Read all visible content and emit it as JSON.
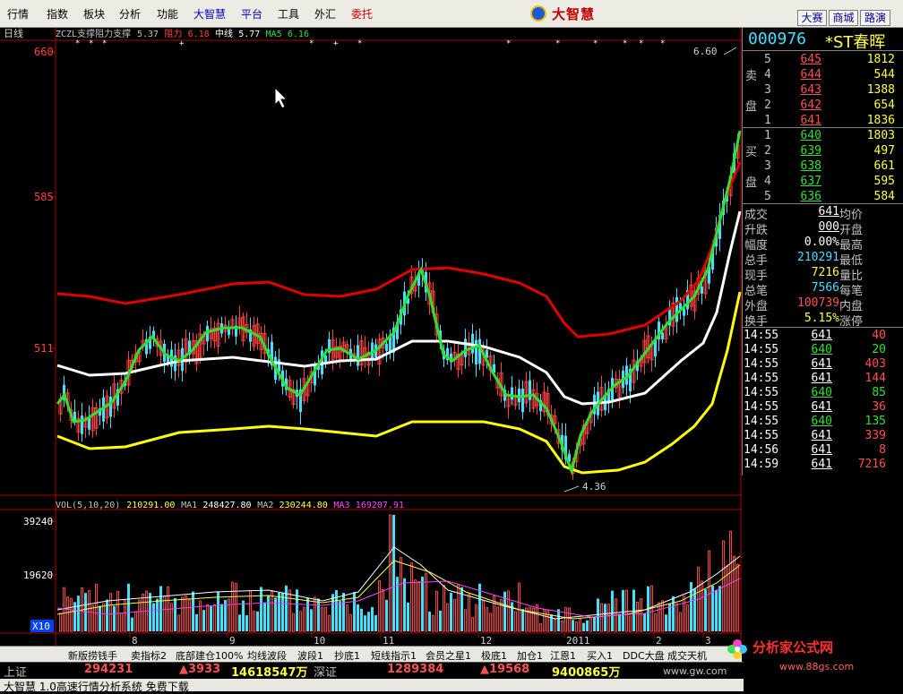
{
  "menu": {
    "items": [
      {
        "label": "行情",
        "color": "black"
      },
      {
        "label": "指数",
        "color": "black"
      },
      {
        "label": "板块",
        "color": "black"
      },
      {
        "label": "分析",
        "color": "black"
      },
      {
        "label": "功能",
        "color": "black"
      },
      {
        "label": "大智慧",
        "color": "blue"
      },
      {
        "label": "平台",
        "color": "blue"
      },
      {
        "label": "工具",
        "color": "black"
      },
      {
        "label": "外汇",
        "color": "black"
      },
      {
        "label": "委托",
        "color": "red"
      }
    ],
    "logo": "大智慧",
    "right_buttons": [
      "大赛",
      "商城",
      "路演"
    ]
  },
  "chart": {
    "period": "日线",
    "indicator_header": [
      {
        "text": "ZCZL支撑阻力支撑",
        "color": "#c0c0c0"
      },
      {
        "text": "5.37",
        "color": "#c0c0c0"
      },
      {
        "text": "阻力",
        "color": "#ff4040"
      },
      {
        "text": "6.18",
        "color": "#ff4040"
      },
      {
        "text": "中线",
        "color": "#ffffff"
      },
      {
        "text": "5.77",
        "color": "#ffffff"
      },
      {
        "text": "MA5",
        "color": "#30e030"
      },
      {
        "text": "6.16",
        "color": "#30e030"
      }
    ],
    "price_ticks": [
      "660",
      "585",
      "511"
    ],
    "high_label": "6.60",
    "low_label": "4.36",
    "volume_header": [
      {
        "text": "VOL(5,10,20)",
        "color": "#c0c0c0"
      },
      {
        "text": "210291.00",
        "color": "#ffff40"
      },
      {
        "text": "MA1",
        "color": "#c0c0c0"
      },
      {
        "text": "248427.80",
        "color": "#ffffff"
      },
      {
        "text": "MA2",
        "color": "#c0c0c0"
      },
      {
        "text": "230244.80",
        "color": "#ffff40"
      },
      {
        "text": "MA3",
        "color": "#ff40ff"
      },
      {
        "text": "169207.91",
        "color": "#ff40ff"
      }
    ],
    "vol_ticks": [
      "39240",
      "19620"
    ],
    "vol_unit": "X10",
    "month_labels": [
      "8",
      "9",
      "10",
      "11",
      "12",
      "2011",
      "2",
      "3"
    ]
  },
  "tabs": [
    "新版捞钱手",
    "卖指标2",
    "底部建仓100%",
    "均线波段",
    "波段1",
    "抄底1",
    "短线指示1",
    "会员之星1",
    "极底1",
    "加仓1",
    "江恩1",
    "买入1",
    "DDC大盘",
    "成交天机"
  ],
  "statusbar": {
    "sh_label": "上证",
    "sh_index": "294231",
    "sh_change": "▲3933",
    "sh_amount": "14618547万",
    "sz_label": "深证",
    "sz_index": "1289384",
    "sz_change": "▲19568",
    "sz_amount": "9400865万",
    "ticker_text": "大智慧   1.0高速行情分析系统   免费下载",
    "url": "www.gw.com"
  },
  "quote": {
    "code": "000976",
    "name": "*ST春晖",
    "sell_label_1": "卖",
    "sell_label_2": "盘",
    "buy_label_1": "买",
    "buy_label_2": "盘",
    "sell": [
      {
        "level": "5",
        "price": "645",
        "vol": "1812"
      },
      {
        "level": "4",
        "price": "644",
        "vol": "544"
      },
      {
        "level": "3",
        "price": "643",
        "vol": "1388"
      },
      {
        "level": "2",
        "price": "642",
        "vol": "654"
      },
      {
        "level": "1",
        "price": "641",
        "vol": "1836"
      }
    ],
    "buy": [
      {
        "level": "1",
        "price": "640",
        "vol": "1803"
      },
      {
        "level": "2",
        "price": "639",
        "vol": "497"
      },
      {
        "level": "3",
        "price": "638",
        "vol": "661"
      },
      {
        "level": "4",
        "price": "637",
        "vol": "595"
      },
      {
        "level": "5",
        "price": "636",
        "vol": "584"
      }
    ],
    "stats": [
      {
        "label": "成交",
        "value": "641",
        "label2": "均价",
        "value_color": "white"
      },
      {
        "label": "升跌",
        "value": "000",
        "label2": "开盘",
        "value_color": "white"
      },
      {
        "label": "幅度",
        "value": "0.00%",
        "label2": "最高",
        "value_color": "white"
      },
      {
        "label": "总手",
        "value": "210291",
        "label2": "最低",
        "value_color": "cyan"
      },
      {
        "label": "现手",
        "value": "7216",
        "label2": "量比",
        "value_color": "yellow"
      },
      {
        "label": "总笔",
        "value": "7566",
        "label2": "每笔",
        "value_color": "cyan"
      },
      {
        "label": "外盘",
        "value": "100739",
        "label2": "内盘",
        "value_color": "red"
      },
      {
        "label": "换手",
        "value": "5.15%",
        "label2": "涨停",
        "value_color": "yellow"
      }
    ],
    "trades": [
      {
        "time": "14:55",
        "price": "641",
        "vol": "40",
        "dir": "red"
      },
      {
        "time": "14:55",
        "price": "640",
        "vol": "20",
        "dir": "green"
      },
      {
        "time": "14:55",
        "price": "641",
        "vol": "403",
        "dir": "red"
      },
      {
        "time": "14:55",
        "price": "641",
        "vol": "144",
        "dir": "red"
      },
      {
        "time": "14:55",
        "price": "640",
        "vol": "85",
        "dir": "green"
      },
      {
        "time": "14:55",
        "price": "641",
        "vol": "36",
        "dir": "red"
      },
      {
        "time": "14:55",
        "price": "640",
        "vol": "135",
        "dir": "green"
      },
      {
        "time": "14:55",
        "price": "641",
        "vol": "339",
        "dir": "red"
      },
      {
        "time": "14:56",
        "price": "641",
        "vol": "8",
        "dir": "red"
      },
      {
        "time": "14:59",
        "price": "641",
        "vol": "7216",
        "dir": "red"
      }
    ]
  },
  "brand": {
    "name": "分析家公式网",
    "url": "www.88gs.com"
  }
}
